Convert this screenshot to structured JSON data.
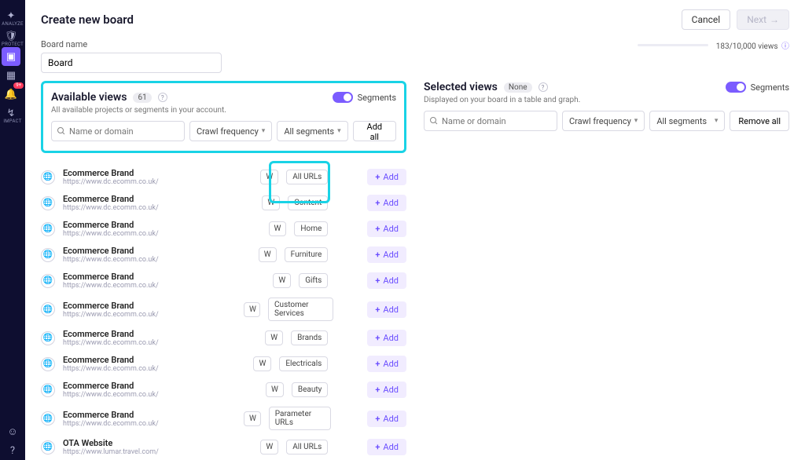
{
  "sidenav": {
    "items": [
      {
        "label": "ANALYZE",
        "icon": "✦"
      },
      {
        "label": "PROTECT",
        "icon": "🛡"
      },
      {
        "label": "",
        "icon": "▣",
        "active": true
      },
      {
        "label": "",
        "icon": "▦"
      },
      {
        "label": "",
        "icon": "🔔",
        "badge": "9+"
      },
      {
        "label": "IMPACT",
        "icon": "↯"
      }
    ],
    "bottom": [
      {
        "icon": "☺"
      },
      {
        "icon": "?"
      }
    ]
  },
  "topbar": {
    "title": "Create new board",
    "cancel": "Cancel",
    "next": "Next"
  },
  "board": {
    "name_label": "Board name",
    "name_value": "Board"
  },
  "meta": {
    "views_count": "183/10,000 views"
  },
  "available": {
    "title": "Available views",
    "count": "61",
    "sub": "All available projects or segments in your account.",
    "segments_label": "Segments",
    "search_placeholder": "Name or domain",
    "crawl_label": "Crawl frequency",
    "segments_filter_label": "All segments",
    "add_all": "Add all"
  },
  "selected": {
    "title": "Selected views",
    "badge": "None",
    "sub": "Displayed on your board in a table and graph.",
    "segments_label": "Segments",
    "search_placeholder": "Name or domain",
    "crawl_label": "Crawl frequency",
    "segments_filter_label": "All segments",
    "remove_all": "Remove all"
  },
  "add_label": "Add",
  "rows": [
    {
      "name": "Ecommerce Brand",
      "url": "https://www.dc.ecomm.co.uk/",
      "freq": "W",
      "segment": "All URLs"
    },
    {
      "name": "Ecommerce Brand",
      "url": "https://www.dc.ecomm.co.uk/",
      "freq": "W",
      "segment": "Content"
    },
    {
      "name": "Ecommerce Brand",
      "url": "https://www.dc.ecomm.co.uk/",
      "freq": "W",
      "segment": "Home"
    },
    {
      "name": "Ecommerce Brand",
      "url": "https://www.dc.ecomm.co.uk/",
      "freq": "W",
      "segment": "Furniture"
    },
    {
      "name": "Ecommerce Brand",
      "url": "https://www.dc.ecomm.co.uk/",
      "freq": "W",
      "segment": "Gifts"
    },
    {
      "name": "Ecommerce Brand",
      "url": "https://www.dc.ecomm.co.uk/",
      "freq": "W",
      "segment": "Customer Services"
    },
    {
      "name": "Ecommerce Brand",
      "url": "https://www.dc.ecomm.co.uk/",
      "freq": "W",
      "segment": "Brands"
    },
    {
      "name": "Ecommerce Brand",
      "url": "https://www.dc.ecomm.co.uk/",
      "freq": "W",
      "segment": "Electricals"
    },
    {
      "name": "Ecommerce Brand",
      "url": "https://www.dc.ecomm.co.uk/",
      "freq": "W",
      "segment": "Beauty"
    },
    {
      "name": "Ecommerce Brand",
      "url": "https://www.dc.ecomm.co.uk/",
      "freq": "W",
      "segment": "Parameter URLs"
    },
    {
      "name": "OTA Website",
      "url": "https://www.lumar.travel.com/",
      "freq": "W",
      "segment": "All URLs"
    }
  ]
}
